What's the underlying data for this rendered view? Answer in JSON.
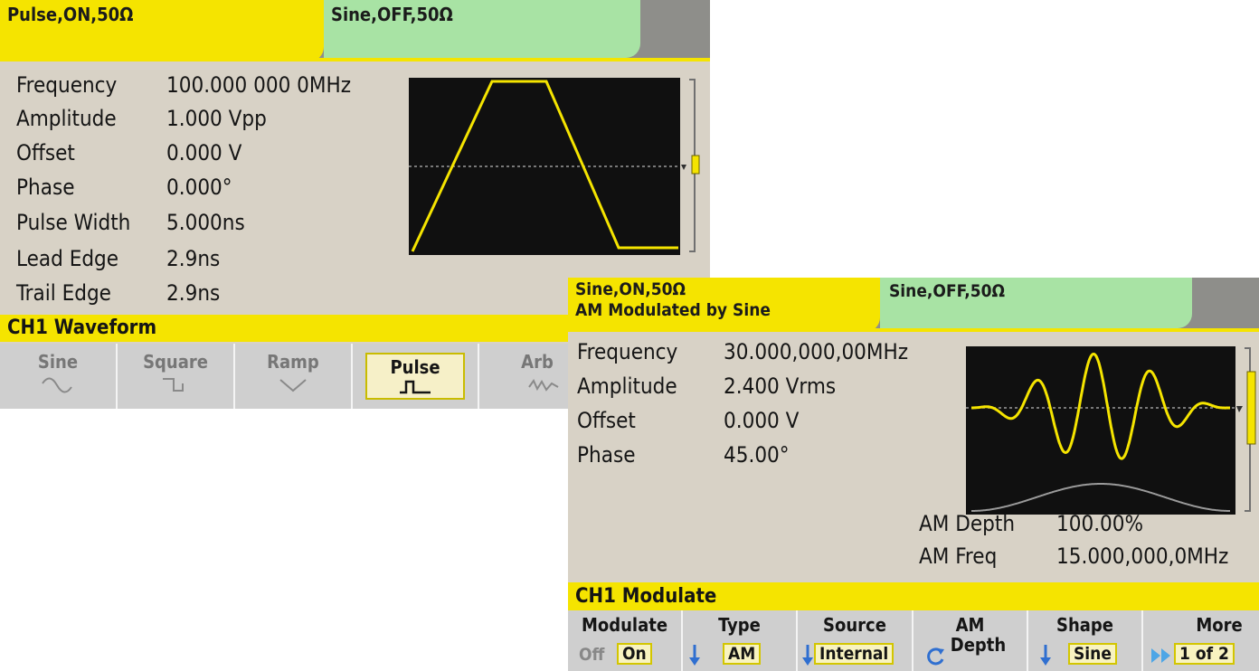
{
  "screen1": {
    "tabs": [
      {
        "label": "Pulse,ON,50Ω"
      },
      {
        "label": "Sine,OFF,50Ω"
      }
    ],
    "fields": [
      {
        "label": "Frequency",
        "value": "100.000 000 0MHz"
      },
      {
        "label": "Amplitude",
        "value": "1.000 Vpp"
      },
      {
        "label": "Offset",
        "value": "0.000 V"
      },
      {
        "label": "Phase",
        "value": "0.000°"
      },
      {
        "label": "Pulse Width",
        "value": "5.000ns"
      },
      {
        "label": "Lead Edge",
        "value": "2.9ns"
      },
      {
        "label": "Trail Edge",
        "value": "2.9ns"
      }
    ],
    "menu_title": "CH1 Waveform",
    "softkeys": [
      {
        "label": "Sine",
        "icon": "sine-wave-icon"
      },
      {
        "label": "Square",
        "icon": "square-wave-icon"
      },
      {
        "label": "Ramp",
        "icon": "ramp-wave-icon"
      },
      {
        "label": "Pulse",
        "icon": "pulse-wave-icon",
        "selected": true
      },
      {
        "label": "Arb",
        "icon": "arb-wave-icon"
      }
    ]
  },
  "screen2": {
    "tabs": [
      {
        "label": "Sine,ON,50Ω",
        "sublabel": "AM Modulated by Sine"
      },
      {
        "label": "Sine,OFF,50Ω"
      }
    ],
    "fields": [
      {
        "label": "Frequency",
        "value": "30.000,000,00MHz"
      },
      {
        "label": "Amplitude",
        "value": "2.400 Vrms"
      },
      {
        "label": "Offset",
        "value": "0.000 V"
      },
      {
        "label": "Phase",
        "value": "45.00°"
      }
    ],
    "mod_fields": [
      {
        "label": "AM Depth",
        "value": "100.00%"
      },
      {
        "label": "AM Freq",
        "value": "15.000,000,0MHz"
      }
    ],
    "menu_title": "CH1 Modulate",
    "softkeys": [
      {
        "label": "Modulate",
        "off": "Off",
        "value": "On"
      },
      {
        "label": "Type",
        "value": "AM"
      },
      {
        "label": "Source",
        "value": "Internal"
      },
      {
        "label": "AM",
        "label2": "Depth"
      },
      {
        "label": "Shape",
        "value": "Sine"
      },
      {
        "label": "More",
        "value": "1 of 2"
      }
    ]
  },
  "colors": {
    "active_tab": "#f5e400",
    "inactive_tab": "#a8e3a4",
    "background": "#d8d2c6",
    "trace": "#f5e400",
    "arrow": "#2f6fd0"
  }
}
